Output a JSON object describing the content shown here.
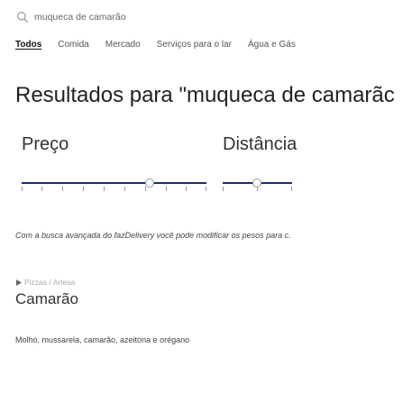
{
  "search": {
    "value": "muqueca de camarão",
    "icon": "search-icon"
  },
  "categories": [
    {
      "label": "Todos",
      "active": true
    },
    {
      "label": "Comida",
      "active": false
    },
    {
      "label": "Mercado",
      "active": false
    },
    {
      "label": "Serviços para o lar",
      "active": false
    },
    {
      "label": "Água e Gás",
      "active": false
    }
  ],
  "results": {
    "title": "Resultados para \"muqueca de camarãc"
  },
  "filters": {
    "price_label": "Preço",
    "distance_label": "Distância"
  },
  "notice": "Com a busca avançada do fazDelivery você pode modificar os pesos para c.",
  "product": {
    "breadcrumb": "Pizzas / Artesa",
    "breadcrumb_icon": "tag-icon",
    "name": "Camarão",
    "description": "Molho, mussarela, camarão, azeitona e orégano"
  },
  "colors": {
    "slider_fill": "#1f2d6b",
    "slider_track": "#bbbbbb"
  }
}
